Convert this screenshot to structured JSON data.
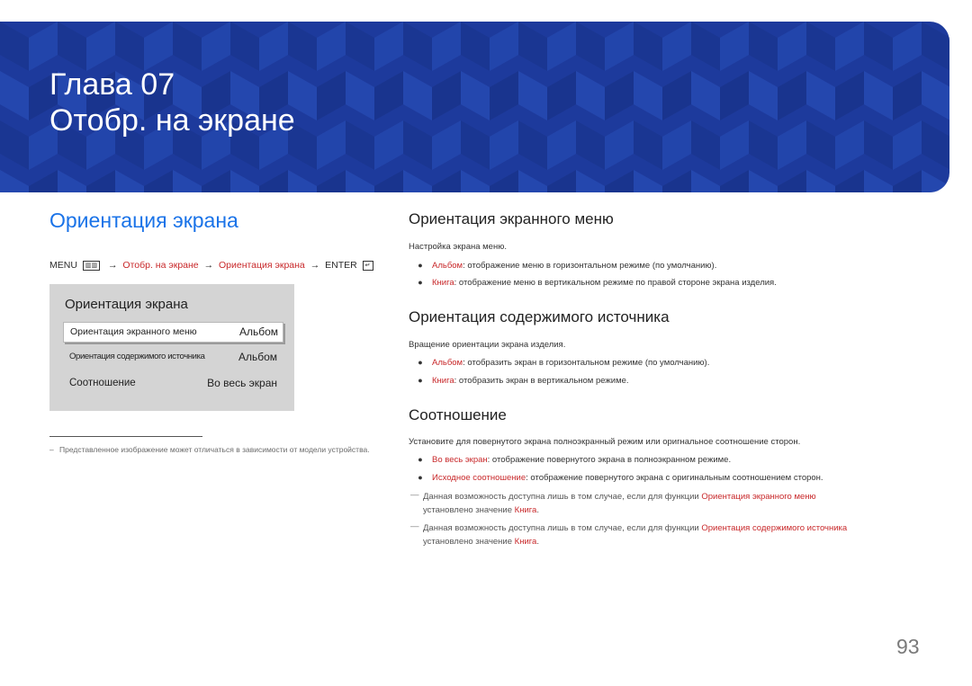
{
  "banner": {
    "chapter_label": "Глава 07",
    "chapter_name": "Отобр. на экране",
    "color": "#1d3a9c"
  },
  "left": {
    "heading": "Ориентация экрана",
    "menu_path": {
      "menu": "MENU",
      "menu_icon": "menu-icon",
      "step1": "Отобр. на экране",
      "step2": "Ориентация экрана",
      "enter": "ENTER",
      "enter_icon": "enter-icon"
    },
    "osd": {
      "title": "Ориентация экрана",
      "rows": [
        {
          "label": "Ориентация экранного меню",
          "value": "Альбом"
        },
        {
          "label": "Ориентация содержимого источника",
          "value": "Альбом"
        },
        {
          "label": "Соотношение",
          "value": "Во весь экран"
        }
      ]
    },
    "footnote": "Представленное изображение может отличаться в зависимости от модели устройства."
  },
  "right": {
    "s1": {
      "heading": "Ориентация экранного меню",
      "desc": "Настройка экрана меню.",
      "b1_term": "Альбом",
      "b1_text": ": отображение меню в горизонтальном режиме (по умолчанию).",
      "b2_term": "Книга",
      "b2_text": ": отображение меню в вертикальном режиме по правой стороне экрана изделия."
    },
    "s2": {
      "heading": "Ориентация содержимого источника",
      "desc": "Вращение ориентации экрана изделия.",
      "b1_term": "Альбом",
      "b1_text": ": отобразить экран в горизонтальном режиме (по умолчанию).",
      "b2_term": "Книга",
      "b2_text": ": отобразить экран в вертикальном режиме."
    },
    "s3": {
      "heading": "Соотношение",
      "desc": "Установите для повернутого экрана полноэкранный режим или оригнальное соотношение сторон.",
      "b1_term": "Во весь экран",
      "b1_text": ": отображение повернутого экрана в полноэкранном режиме.",
      "b2_term": "Исходное соотношение",
      "b2_text": ": отображение повернутого экрана с оригинальным соотношением сторон.",
      "note1": {
        "pre": "Данная возможность доступна лишь в том случае, если для функции ",
        "link": "Ориентация экранного меню",
        "mid": "установлено значение ",
        "value": "Книга",
        "end": "."
      },
      "note2": {
        "pre": "Данная возможность доступна лишь в том случае, если для функции ",
        "link": "Ориентация содержимого источника",
        "mid": "установлено значение ",
        "value": "Книга",
        "end": "."
      }
    }
  },
  "page_number": "93",
  "colors": {
    "accent_blue": "#1a73e8",
    "highlight_red": "#c8282a"
  }
}
